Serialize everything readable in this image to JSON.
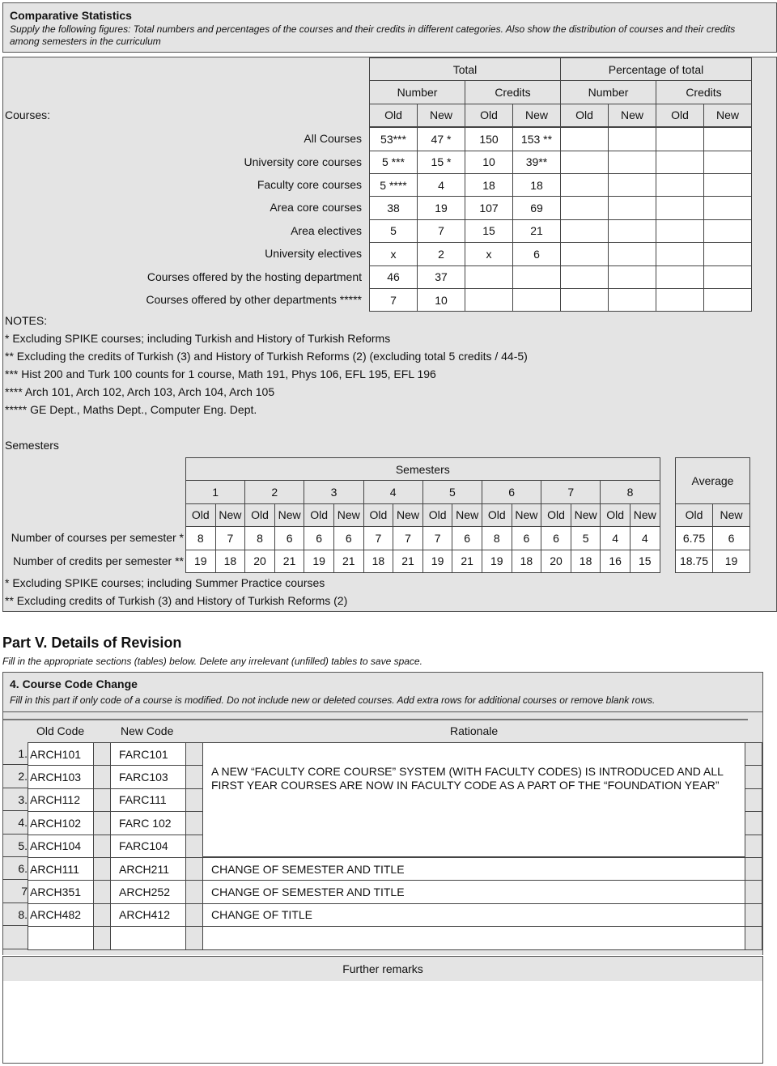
{
  "comparative": {
    "title": "Comparative Statistics",
    "subtitle": "Supply the following  figures: Total numbers and percentages of the courses and their credits in different categories. Also show  the distribution of courses and their credits among semesters in the curriculum",
    "courses_label": "Courses:",
    "group_headers": [
      "Total",
      "Percentage of total"
    ],
    "sub_headers": [
      "Number",
      "Credits",
      "Number",
      "Credits"
    ],
    "col_headers": [
      "Old",
      "New",
      "Old",
      "New",
      "Old",
      "New",
      "Old",
      "New"
    ],
    "rows": [
      {
        "label": "All Courses",
        "values": [
          "53***",
          "47 *",
          "150",
          "153 **",
          "",
          "",
          "",
          ""
        ]
      },
      {
        "label": "University core courses",
        "values": [
          "5 ***",
          "15 *",
          "10",
          "39**",
          "",
          "",
          "",
          ""
        ]
      },
      {
        "label": "Faculty core courses",
        "values": [
          "5 ****",
          "4",
          "18",
          "18",
          "",
          "",
          "",
          ""
        ]
      },
      {
        "label": "Area core courses",
        "values": [
          "38",
          "19",
          "107",
          "69",
          "",
          "",
          "",
          ""
        ]
      },
      {
        "label": "Area electives",
        "values": [
          "5",
          "7",
          "15",
          "21",
          "",
          "",
          "",
          ""
        ]
      },
      {
        "label": "University electives",
        "values": [
          "x",
          "2",
          "x",
          "6",
          "",
          "",
          "",
          ""
        ]
      },
      {
        "label": "Courses offered by the hosting department",
        "values": [
          "46",
          "37",
          "",
          "",
          "",
          "",
          "",
          ""
        ]
      },
      {
        "label": "Courses offered by other departments *****",
        "values": [
          "7",
          "10",
          "",
          "",
          "",
          "",
          "",
          ""
        ]
      }
    ],
    "notes_title": "NOTES:",
    "notes": [
      "* Excluding SPIKE courses; including Turkish and History of Turkish Reforms",
      "** Excluding the credits of Turkish (3) and History of Turkish Reforms (2) (excluding total 5 credits / 44-5)",
      "*** Hist 200 and Turk 100 counts for 1 course, Math 191, Phys 106, EFL 195, EFL 196",
      "**** Arch 101, Arch 102, Arch 103, Arch 104, Arch 105",
      "***** GE Dept., Maths Dept., Computer Eng. Dept."
    ]
  },
  "semesters": {
    "section_label": "Semesters",
    "header": "Semesters",
    "semester_numbers": [
      "1",
      "2",
      "3",
      "4",
      "5",
      "6",
      "7",
      "8"
    ],
    "old_label": "Old",
    "new_label": "New",
    "average_label": "Average",
    "rows": [
      {
        "label": "Number of courses per semester *",
        "values": [
          "8",
          "7",
          "8",
          "6",
          "6",
          "6",
          "7",
          "7",
          "7",
          "6",
          "8",
          "6",
          "6",
          "5",
          "4",
          "4"
        ],
        "avg_old": "6.75",
        "avg_new": "6"
      },
      {
        "label": "Number of credits per semester **",
        "values": [
          "19",
          "18",
          "20",
          "21",
          "19",
          "21",
          "18",
          "21",
          "19",
          "21",
          "19",
          "18",
          "20",
          "18",
          "16",
          "15"
        ],
        "avg_old": "18.75",
        "avg_new": "19"
      }
    ],
    "notes": [
      "* Excluding SPIKE courses; including Summer Practice courses",
      "** Excluding credits of Turkish (3) and History of Turkish Reforms (2)"
    ]
  },
  "part5": {
    "title": "Part V. Details of Revision",
    "instruction": "Fill in the appropriate sections (tables) below. Delete any irrelevant (unfilled) tables to save space.",
    "section_title": "4. Course Code Change",
    "section_instruction": "Fill in this part if only code of a course is modified. Do not include new or deleted courses. Add extra rows for additional courses or remove blank rows.",
    "headers": {
      "old_code": "Old Code",
      "new_code": "New Code",
      "rationale": "Rationale"
    },
    "rows": [
      {
        "num": "1.",
        "old": "ARCH101",
        "new": "FARC101"
      },
      {
        "num": "2.",
        "old": "ARCH103",
        "new": "FARC103"
      },
      {
        "num": "3.",
        "old": "ARCH112",
        "new": "FARC111"
      },
      {
        "num": "4.",
        "old": "ARCH102",
        "new": "FARC 102"
      },
      {
        "num": "5.",
        "old": "ARCH104",
        "new": "FARC104"
      },
      {
        "num": "6.",
        "old": "ARCH111",
        "new": "ARCH211",
        "rationale": "CHANGE OF SEMESTER AND TITLE"
      },
      {
        "num": "7",
        "old": "ARCH351",
        "new": "ARCH252",
        "rationale": "CHANGE OF SEMESTER AND TITLE"
      },
      {
        "num": "8.",
        "old": "ARCH482",
        "new": "ARCH412",
        "rationale": "CHANGE OF TITLE"
      },
      {
        "num": "",
        "old": "",
        "new": ""
      }
    ],
    "merged_rationale": "A NEW “FACULTY CORE COURSE” SYSTEM (WITH FACULTY CODES) IS INTRODUCED AND ALL FIRST YEAR COURSES ARE NOW IN FACULTY CODE AS A PART OF THE “FOUNDATION YEAR”",
    "further_remarks_label": "Further remarks",
    "further_remarks": ""
  }
}
